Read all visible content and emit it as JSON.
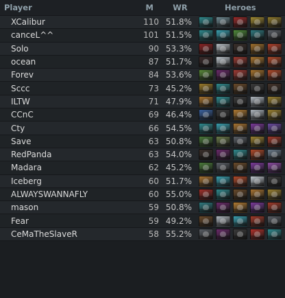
{
  "header": {
    "player": "Player",
    "m": "M",
    "wr": "WR",
    "heroes": "Heroes"
  },
  "rows": [
    {
      "player": "XCalibur",
      "m": "110",
      "wr": "51.8%",
      "heroes": [
        {
          "icon": "hero-portrait-teal",
          "color": "#2f8a8e"
        },
        {
          "icon": "hero-portrait-steel",
          "color": "#6f8a93"
        },
        {
          "icon": "hero-portrait-crimson",
          "color": "#9a2a2a"
        },
        {
          "icon": "hero-portrait-gold",
          "color": "#a08a32"
        },
        {
          "icon": "hero-portrait-gold",
          "color": "#8f7a2c"
        }
      ]
    },
    {
      "player": "canceL^^",
      "m": "101",
      "wr": "51.5%",
      "heroes": [
        {
          "icon": "hero-portrait-teal",
          "color": "#2f8a8e"
        },
        {
          "icon": "hero-portrait-cyan",
          "color": "#3aa0b0"
        },
        {
          "icon": "hero-portrait-green",
          "color": "#4f8a3a"
        },
        {
          "icon": "hero-portrait-teal",
          "color": "#2f7a80"
        },
        {
          "icon": "hero-portrait-grey",
          "color": "#5a5f66"
        }
      ]
    },
    {
      "player": "Solo",
      "m": "90",
      "wr": "53.3%",
      "heroes": [
        {
          "icon": "hero-portrait-crimson",
          "color": "#8a2424"
        },
        {
          "icon": "hero-portrait-pale",
          "color": "#b9c0c6"
        },
        {
          "icon": "hero-portrait-dark",
          "color": "#3a2f2a"
        },
        {
          "icon": "hero-portrait-amber",
          "color": "#a0702c"
        },
        {
          "icon": "hero-portrait-red",
          "color": "#b0402a"
        }
      ]
    },
    {
      "player": "ocean",
      "m": "87",
      "wr": "51.7%",
      "heroes": [
        {
          "icon": "hero-portrait-dark",
          "color": "#3a2a2a"
        },
        {
          "icon": "hero-portrait-pale",
          "color": "#c0c8cf"
        },
        {
          "icon": "hero-portrait-red",
          "color": "#9a3a32"
        },
        {
          "icon": "hero-portrait-amber",
          "color": "#a8742e"
        },
        {
          "icon": "hero-portrait-red",
          "color": "#b04a2a"
        }
      ]
    },
    {
      "player": "Forev",
      "m": "84",
      "wr": "53.6%",
      "heroes": [
        {
          "icon": "hero-portrait-green",
          "color": "#5a8a3a"
        },
        {
          "icon": "hero-portrait-purple",
          "color": "#6a2a6a"
        },
        {
          "icon": "hero-portrait-red",
          "color": "#a03a34"
        },
        {
          "icon": "hero-portrait-amber",
          "color": "#a8742e"
        },
        {
          "icon": "hero-portrait-red",
          "color": "#b04a2a"
        }
      ]
    },
    {
      "player": "Sccc",
      "m": "73",
      "wr": "45.2%",
      "heroes": [
        {
          "icon": "hero-portrait-gold",
          "color": "#9a7a2a"
        },
        {
          "icon": "hero-portrait-teal",
          "color": "#2f8a8e"
        },
        {
          "icon": "hero-portrait-brown",
          "color": "#6a4a2a"
        },
        {
          "icon": "hero-portrait-dark",
          "color": "#3a3a3a"
        },
        {
          "icon": "hero-portrait-dark",
          "color": "#44332a"
        }
      ]
    },
    {
      "player": "ILTW",
      "m": "71",
      "wr": "47.9%",
      "heroes": [
        {
          "icon": "hero-portrait-amber",
          "color": "#a8742e"
        },
        {
          "icon": "hero-portrait-teal",
          "color": "#2f8a8e"
        },
        {
          "icon": "hero-portrait-dark",
          "color": "#3a3a3a"
        },
        {
          "icon": "hero-portrait-pale",
          "color": "#b0b8c0"
        },
        {
          "icon": "hero-portrait-gold",
          "color": "#9a8030"
        }
      ]
    },
    {
      "player": "CCnC",
      "m": "69",
      "wr": "46.4%",
      "heroes": [
        {
          "icon": "hero-portrait-blue",
          "color": "#3a62a0"
        },
        {
          "icon": "hero-portrait-dark",
          "color": "#3a3a3a"
        },
        {
          "icon": "hero-portrait-amber",
          "color": "#b07a32"
        },
        {
          "icon": "hero-portrait-pale",
          "color": "#b0b8c0"
        },
        {
          "icon": "hero-portrait-gold",
          "color": "#9a8030"
        }
      ]
    },
    {
      "player": "Cty",
      "m": "66",
      "wr": "54.5%",
      "heroes": [
        {
          "icon": "hero-portrait-teal",
          "color": "#2f8a8e"
        },
        {
          "icon": "hero-portrait-cyan",
          "color": "#3aa0b0"
        },
        {
          "icon": "hero-portrait-amber",
          "color": "#a87432"
        },
        {
          "icon": "hero-portrait-purple",
          "color": "#7a3a9a"
        },
        {
          "icon": "hero-portrait-violet",
          "color": "#6a4aa0"
        }
      ]
    },
    {
      "player": "Save",
      "m": "63",
      "wr": "50.8%",
      "heroes": [
        {
          "icon": "hero-portrait-green",
          "color": "#4a7a3a"
        },
        {
          "icon": "hero-portrait-olive",
          "color": "#6a7a4a"
        },
        {
          "icon": "hero-portrait-grey",
          "color": "#5a5f66"
        },
        {
          "icon": "hero-portrait-gold",
          "color": "#9a8030"
        },
        {
          "icon": "hero-portrait-red",
          "color": "#a03a2a"
        }
      ]
    },
    {
      "player": "RedPanda",
      "m": "63",
      "wr": "54.0%",
      "heroes": [
        {
          "icon": "hero-portrait-dark",
          "color": "#3a2f2a"
        },
        {
          "icon": "hero-portrait-purple",
          "color": "#6a2a6a"
        },
        {
          "icon": "hero-portrait-teal",
          "color": "#2f8a8e"
        },
        {
          "icon": "hero-portrait-red",
          "color": "#b04a2a"
        },
        {
          "icon": "hero-portrait-steel",
          "color": "#6a7a8a"
        }
      ]
    },
    {
      "player": "Madara",
      "m": "62",
      "wr": "45.2%",
      "heroes": [
        {
          "icon": "hero-portrait-green",
          "color": "#4a7a3a"
        },
        {
          "icon": "hero-portrait-grey",
          "color": "#5a5f66"
        },
        {
          "icon": "hero-portrait-brown",
          "color": "#6a4a2a"
        },
        {
          "icon": "hero-portrait-purple",
          "color": "#7a3a9a"
        },
        {
          "icon": "hero-portrait-violet",
          "color": "#8a4aa0"
        }
      ]
    },
    {
      "player": "Iceberg",
      "m": "60",
      "wr": "51.7%",
      "heroes": [
        {
          "icon": "hero-portrait-amber",
          "color": "#a87432"
        },
        {
          "icon": "hero-portrait-cyan",
          "color": "#3aa0b0"
        },
        {
          "icon": "hero-portrait-red",
          "color": "#b04a2a"
        },
        {
          "icon": "hero-portrait-pale",
          "color": "#c0c8cf"
        },
        {
          "icon": "hero-portrait-dark",
          "color": "#3a3a3a"
        }
      ]
    },
    {
      "player": "ALWAYSWANNAFLY",
      "m": "60",
      "wr": "55.0%",
      "heroes": [
        {
          "icon": "hero-portrait-red",
          "color": "#a0302a"
        },
        {
          "icon": "hero-portrait-teal",
          "color": "#2f8a8e"
        },
        {
          "icon": "hero-portrait-brown",
          "color": "#6a4a2a"
        },
        {
          "icon": "hero-portrait-amber",
          "color": "#a87432"
        },
        {
          "icon": "hero-portrait-gold",
          "color": "#9a8030"
        }
      ]
    },
    {
      "player": "mason",
      "m": "59",
      "wr": "50.8%",
      "heroes": [
        {
          "icon": "hero-portrait-teal",
          "color": "#2f7a80"
        },
        {
          "icon": "hero-portrait-purple",
          "color": "#6a2a6a"
        },
        {
          "icon": "hero-portrait-amber",
          "color": "#b07a32"
        },
        {
          "icon": "hero-portrait-purple",
          "color": "#7a3a9a"
        },
        {
          "icon": "hero-portrait-red",
          "color": "#a03a2a"
        }
      ]
    },
    {
      "player": "Fear",
      "m": "59",
      "wr": "49.2%",
      "heroes": [
        {
          "icon": "hero-portrait-brown",
          "color": "#6a4a2a"
        },
        {
          "icon": "hero-portrait-pale",
          "color": "#b0b8c0"
        },
        {
          "icon": "hero-portrait-cyan",
          "color": "#3aa0b0"
        },
        {
          "icon": "hero-portrait-red",
          "color": "#a03a2a"
        },
        {
          "icon": "hero-portrait-grey",
          "color": "#5a5f66"
        }
      ]
    },
    {
      "player": "CeMaTheSlaveR",
      "m": "58",
      "wr": "55.2%",
      "heroes": [
        {
          "icon": "hero-portrait-grey",
          "color": "#5a5f66"
        },
        {
          "icon": "hero-portrait-purple",
          "color": "#6a2a6a"
        },
        {
          "icon": "hero-portrait-dark",
          "color": "#3a3a3a"
        },
        {
          "icon": "hero-portrait-red",
          "color": "#b0302a"
        },
        {
          "icon": "hero-portrait-teal",
          "color": "#2f8a8e"
        }
      ]
    }
  ]
}
